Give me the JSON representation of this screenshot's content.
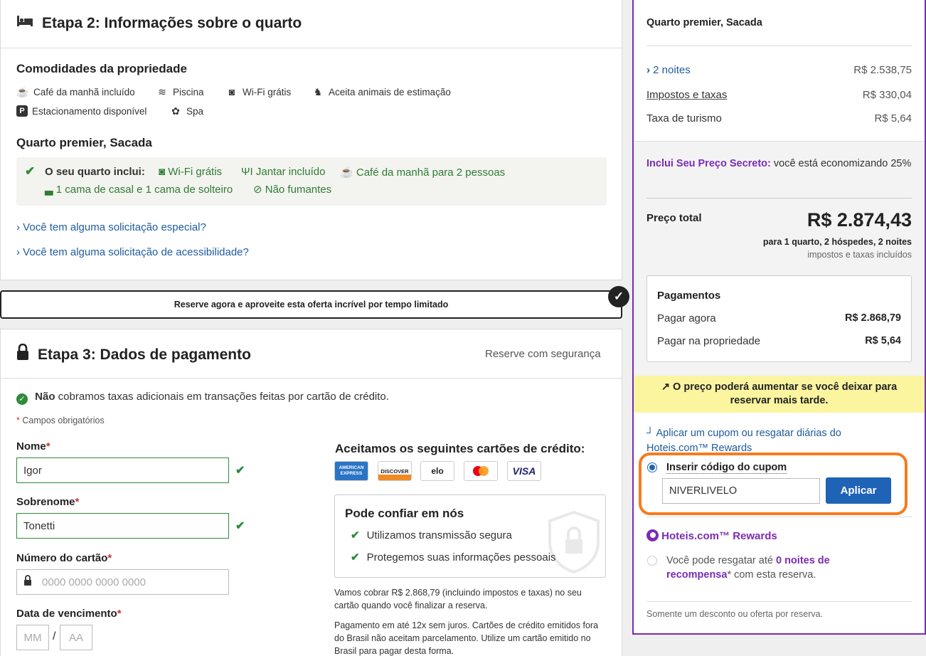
{
  "step2": {
    "title": "Etapa 2: Informações sobre o quarto",
    "amenities_title": "Comodidades da propriedade",
    "amenities": [
      "Café da manhã incluído",
      "Piscina",
      "Wi-Fi grátis",
      "Aceita animais de estimação",
      "Estacionamento disponível",
      "Spa"
    ],
    "room_title": "Quarto premier, Sacada",
    "includes_label": "O seu quarto inclui:",
    "includes": [
      "Wi-Fi grátis",
      "Jantar incluído",
      "Café da manhã para 2 pessoas",
      "1 cama de casal e 1 cama de solteiro",
      "Não fumantes"
    ],
    "special_request": "Você tem alguma solicitação especial?",
    "accessibility_request": "Você tem alguma solicitação de acessibilidade?"
  },
  "banner": {
    "text": "Reserve agora e aproveite esta oferta incrível por tempo limitado"
  },
  "step3": {
    "title": "Etapa 3: Dados de pagamento",
    "secure": "Reserve com segurança",
    "no_fee_bold": "Não",
    "no_fee_rest": " cobramos taxas adicionais em transações feitas por cartão de crédito.",
    "required_note": "Campos obrigatórios",
    "required_star": "*",
    "first_name_label": "Nome",
    "first_name_value": "Igor",
    "last_name_label": "Sobrenome",
    "last_name_value": "Tonetti",
    "card_number_label": "Número do cartão",
    "card_number_placeholder": "0000 0000 0000 0000",
    "expiry_label": "Data de vencimento",
    "expiry_mm": "MM",
    "expiry_sep": "/",
    "expiry_aa": "AA",
    "cards_title": "Aceitamos os seguintes cartões de crédito:",
    "cards": [
      "AMERICAN EXPRESS",
      "DISCOVER",
      "elo",
      "mastercard",
      "VISA"
    ],
    "trust_title": "Pode confiar em nós",
    "trust_items": [
      "Utilizamos transmissão segura",
      "Protegemos suas informações pessoais"
    ],
    "charge_note": "Vamos cobrar R$ 2.868,79 (incluindo impostos e taxas) no seu cartão quando você finalizar a reserva.",
    "installments_note": "Pagamento em até 12x sem juros. Cartões de crédito emitidos fora do Brasil não aceitam parcelamento. Utilize um cartão emitido no Brasil para pagar desta forma."
  },
  "summary": {
    "room": "Quarto premier, Sacada",
    "nights_label": "2 noites",
    "nights_value": "R$ 2.538,75",
    "taxes_label": "Impostos e taxas",
    "taxes_value": "R$ 330,04",
    "tourism_label": "Taxa de turismo",
    "tourism_value": "R$ 5,64",
    "secret_bold": "Inclui Seu Preço Secreto:",
    "secret_rest": " você está economizando 25%",
    "total_label": "Preço total",
    "total_value": "R$ 2.874,43",
    "total_detail": "para 1 quarto, 2 hóspedes, 2 noites",
    "total_taxes": "impostos e taxas incluídos",
    "payments_title": "Pagamentos",
    "pay_now_label": "Pagar agora",
    "pay_now_value": "R$ 2.868,79",
    "pay_property_label": "Pagar na propriedade",
    "pay_property_value": "R$ 5,64",
    "price_warning": "O preço poderá aumentar se você deixar para reservar mais tarde.",
    "coupon_link": "Aplicar um cupom ou resgatar diárias do Hoteis.com™ Rewards",
    "coupon_option": "Inserir código do cupom",
    "coupon_value": "NIVERLIVELO",
    "apply_button": "Aplicar",
    "rewards_title": "Hoteis.com™ Rewards",
    "rewards_pre": "Você pode resgatar até ",
    "rewards_bold": "0 noites de recompensa",
    "rewards_post": "* com esta reserva.",
    "footer_note": "Somente um desconto ou oferta por reserva."
  },
  "colors": {
    "accent_purple": "#7b2bb5",
    "button_blue": "#1f63b7",
    "highlight_orange": "#f57c1f",
    "warning_yellow": "#fbf5a0",
    "success_green": "#2e8b3a"
  }
}
